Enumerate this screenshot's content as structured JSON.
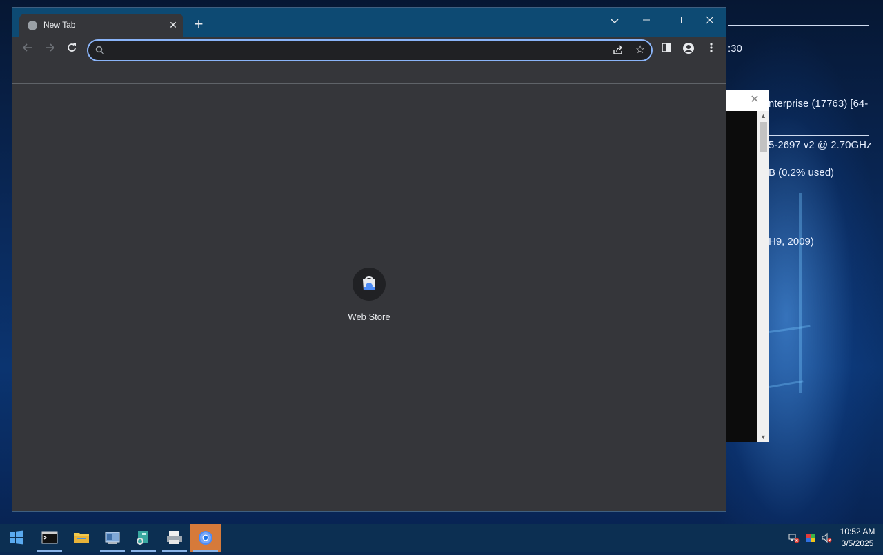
{
  "browser": {
    "tab_title": "New Tab",
    "omnibox_value": "",
    "shortcuts": [
      {
        "label": "Web Store"
      }
    ]
  },
  "desktop": {
    "bginfo": [
      ":30",
      "nterprise (17763) [64-",
      "5-2697 v2 @ 2.70GHz",
      "B (0.2% used)",
      "H9, 2009)"
    ]
  },
  "taskbar": {
    "time": "10:52 AM",
    "date": "3/5/2025",
    "apps": [
      "start",
      "terminal",
      "file-explorer",
      "server-manager",
      "network",
      "print-management",
      "chrome"
    ]
  },
  "colors": {
    "accent": "#8ab4f8",
    "titlebar": "#0d4a73",
    "window_bg": "#35363a",
    "active_app": "#d67a3a"
  }
}
